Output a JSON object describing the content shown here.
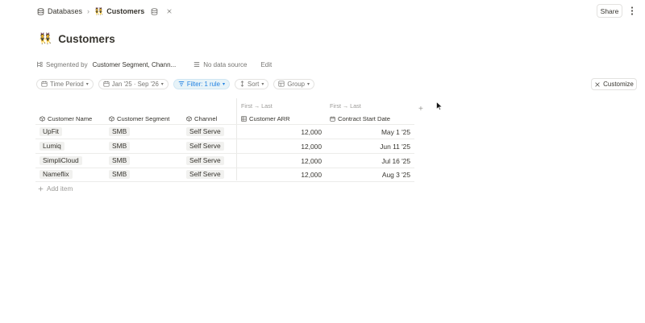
{
  "breadcrumb": {
    "root": "Databases",
    "current": "Customers",
    "separator": "›"
  },
  "topbar": {
    "share_label": "Share"
  },
  "page": {
    "emoji": "👯",
    "title": "Customers"
  },
  "segmented": {
    "label": "Segmented by",
    "value": "Customer Segment, Chann...",
    "datasource": "No data source",
    "edit_label": "Edit"
  },
  "chips": {
    "time_period": "Time Period",
    "date_range": "Jan '25 · Sep '26",
    "filter": "Filter: 1 rule",
    "sort": "Sort",
    "group": "Group",
    "customize": "Customize"
  },
  "table": {
    "columns": {
      "name": "Customer Name",
      "segment": "Customer Segment",
      "channel": "Channel",
      "arr_sub": "First → Last",
      "arr": "Customer ARR",
      "date_sub": "First → Last",
      "date": "Contract Start Date"
    },
    "rows": [
      {
        "name": "UpFit",
        "segment": "SMB",
        "channel": "Self Serve",
        "arr": "12,000",
        "date": "May 1 '25"
      },
      {
        "name": "Lumiq",
        "segment": "SMB",
        "channel": "Self Serve",
        "arr": "12,000",
        "date": "Jun 11 '25"
      },
      {
        "name": "SimpliCloud",
        "segment": "SMB",
        "channel": "Self Serve",
        "arr": "12,000",
        "date": "Jul 16 '25"
      },
      {
        "name": "Nameflix",
        "segment": "SMB",
        "channel": "Self Serve",
        "arr": "12,000",
        "date": "Aug 3 '25"
      }
    ],
    "add_item": "Add item",
    "add_column": "+"
  },
  "colors": {
    "accent": "#2383e2",
    "text": "#37352f",
    "muted": "#9b9a97"
  }
}
